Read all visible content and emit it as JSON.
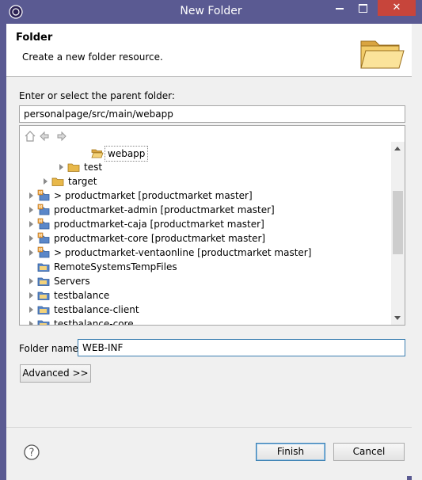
{
  "window": {
    "title": "New Folder",
    "close_glyph": "✕"
  },
  "header": {
    "title": "Folder",
    "description": "Create a new folder resource.",
    "banner_icon": "folder-open-icon"
  },
  "parent": {
    "label": "Enter or select the parent folder:",
    "value": "personalpage/src/main/webapp"
  },
  "tree": {
    "toolbar_icons": [
      "home-icon",
      "back-icon",
      "forward-icon"
    ],
    "items": [
      {
        "label": "webapp",
        "icon": "folder-open-icon",
        "expander": false,
        "selected": true
      },
      {
        "label": "test",
        "icon": "folder-icon",
        "expander": true,
        "selected": false
      },
      {
        "label": "target",
        "icon": "folder-icon",
        "expander": true,
        "selected": false
      },
      {
        "label": "> productmarket  [productmarket master]",
        "icon": "project-icon",
        "expander": true,
        "selected": false
      },
      {
        "label": "productmarket-admin  [productmarket master]",
        "icon": "project-icon",
        "expander": true,
        "selected": false
      },
      {
        "label": "productmarket-caja  [productmarket master]",
        "icon": "project-icon",
        "expander": true,
        "selected": false
      },
      {
        "label": "productmarket-core  [productmarket master]",
        "icon": "project-icon",
        "expander": true,
        "selected": false
      },
      {
        "label": "> productmarket-ventaonline  [productmarket master]",
        "icon": "project-icon",
        "expander": true,
        "selected": false
      },
      {
        "label": "RemoteSystemsTempFiles",
        "icon": "folder-project-icon",
        "expander": false,
        "selected": false
      },
      {
        "label": "Servers",
        "icon": "folder-project-icon",
        "expander": true,
        "selected": false
      },
      {
        "label": "testbalance",
        "icon": "folder-project-icon",
        "expander": true,
        "selected": false
      },
      {
        "label": "testbalance-client",
        "icon": "folder-project-icon",
        "expander": true,
        "selected": false
      },
      {
        "label": "testbalance-core",
        "icon": "folder-project-icon",
        "expander": true,
        "selected": false
      }
    ]
  },
  "folder_name": {
    "label": "Folder name:",
    "value": "WEB-INF"
  },
  "buttons": {
    "advanced": "Advanced >>",
    "finish": "Finish",
    "cancel": "Cancel"
  },
  "colors": {
    "titlebar": "#5a5a92",
    "close": "#c7453b",
    "folder": "#e8b84a"
  }
}
